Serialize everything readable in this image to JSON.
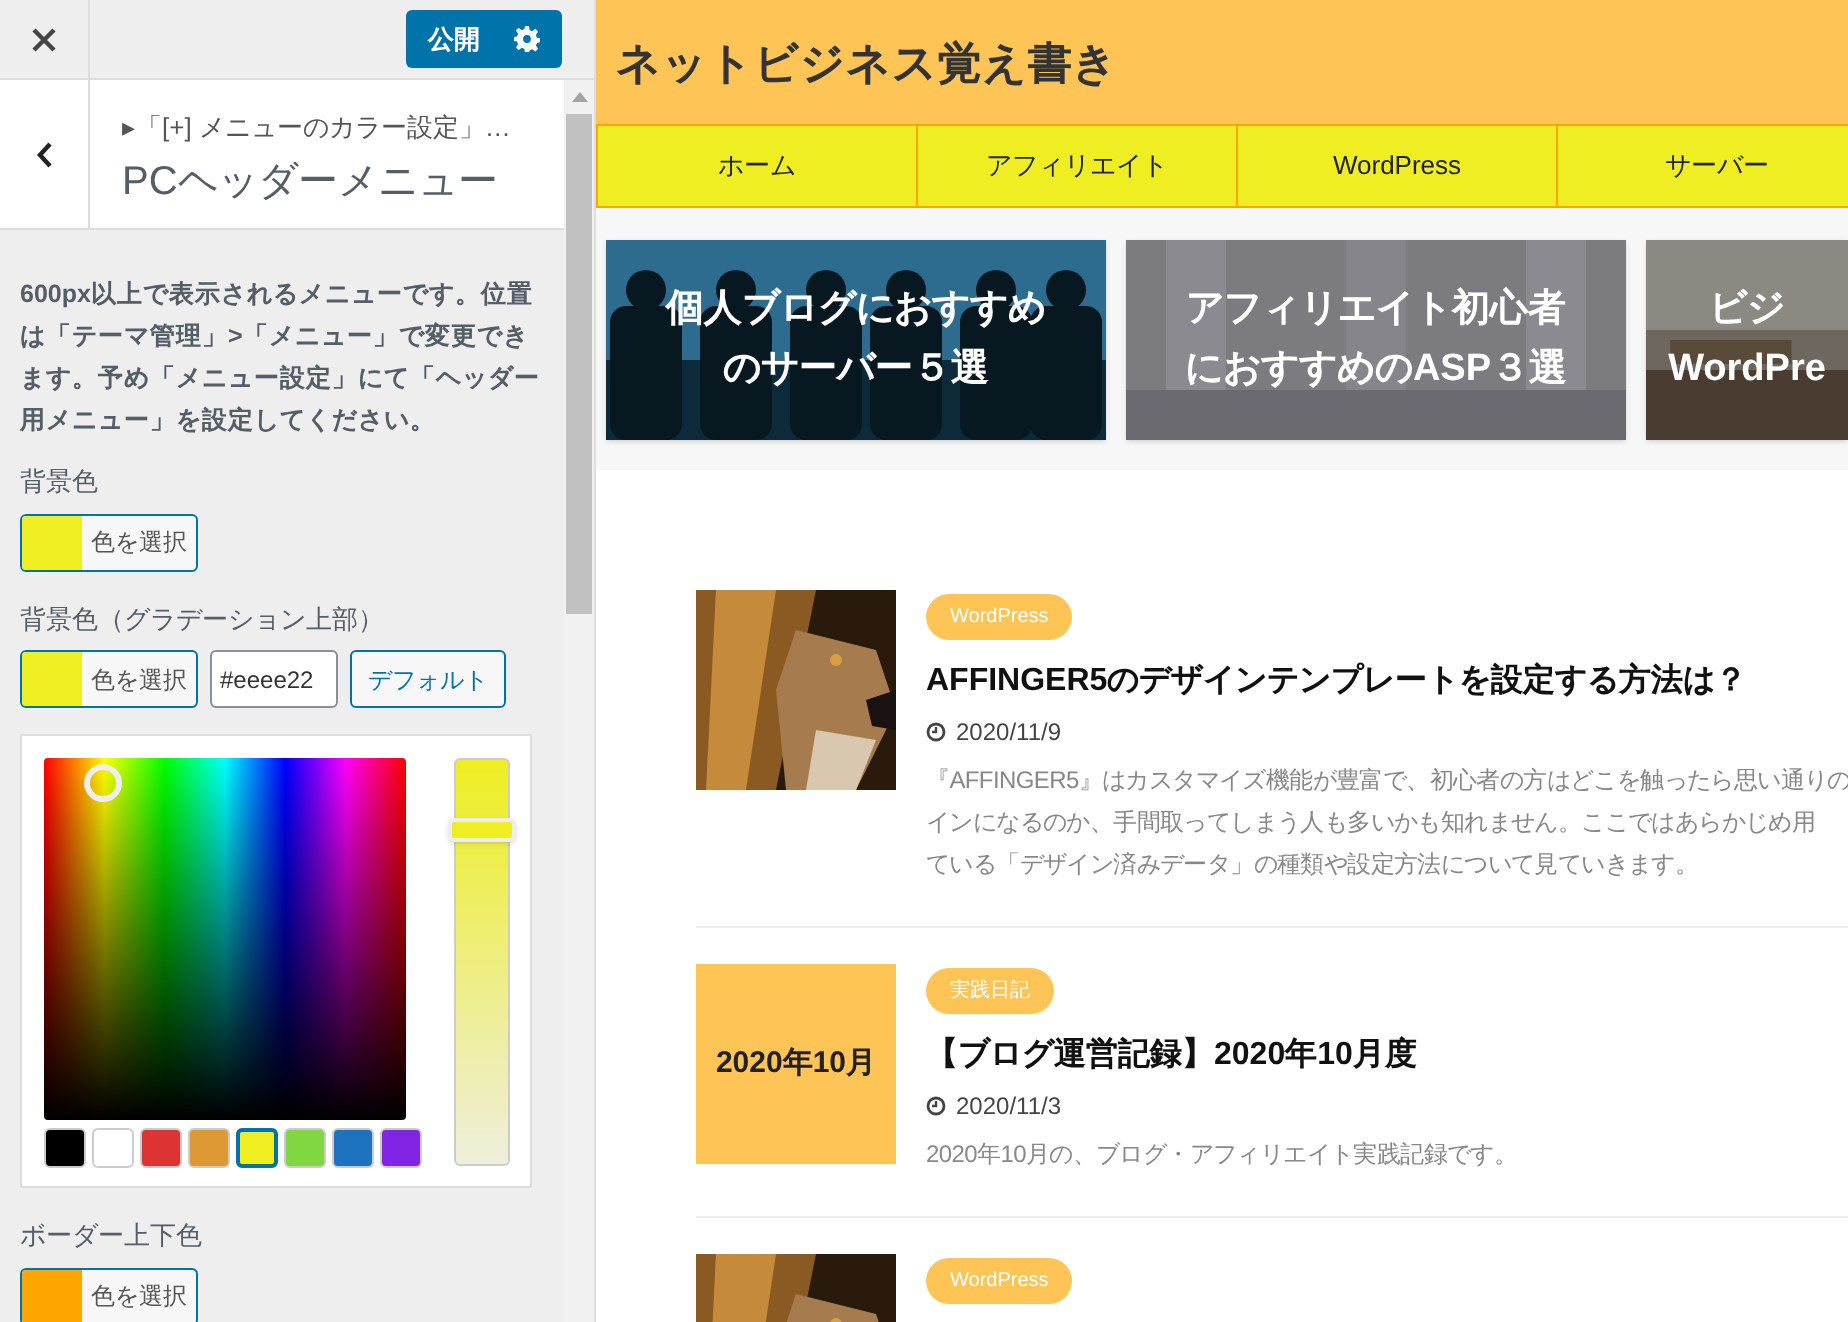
{
  "customizer": {
    "publish_button": "公開",
    "breadcrumb": "▸「[+] メニューのカラー設定」…",
    "section_title": "PCヘッダーメニュー",
    "description": "600px以上で表示されるメニューです。位置は「テーマ管理」>「メニュー」で変更できます。予め「メニュー設定」にて「ヘッダー用メニュー」を設定してください。",
    "controls": [
      {
        "label": "背景色",
        "button": "色を選択",
        "color": "#eeee22"
      },
      {
        "label": "背景色（グラデーション上部）",
        "button": "色を選択",
        "color": "#eeee22",
        "value": "#eeee22",
        "default_button": "デフォルト",
        "picker": {
          "level": 0.85,
          "palette": [
            {
              "color": "#000000",
              "selected": false
            },
            {
              "color": "#ffffff",
              "selected": false
            },
            {
              "color": "#dd3333",
              "selected": false
            },
            {
              "color": "#dd9933",
              "selected": false
            },
            {
              "color": "#eeee22",
              "selected": true
            },
            {
              "color": "#81d742",
              "selected": false
            },
            {
              "color": "#1e73be",
              "selected": false
            },
            {
              "color": "#8224e3",
              "selected": false
            }
          ]
        }
      },
      {
        "label": "ボーダー上下色",
        "button": "色を選択",
        "color": "#ffa500"
      }
    ]
  },
  "site": {
    "title": "ネットビジネス覚え書き",
    "menu": [
      {
        "label": "ホーム"
      },
      {
        "label": "アフィリエイト"
      },
      {
        "label": "WordPress"
      },
      {
        "label": "サーバー"
      }
    ],
    "featured": [
      {
        "lines": [
          "個人ブログにおすすめ",
          "のサーバー５選"
        ],
        "kind": "people"
      },
      {
        "lines": [
          "アフィリエイト初心者",
          "におすすめのASP３選"
        ],
        "kind": "room"
      },
      {
        "lines": [
          "ビジ",
          "WordPre"
        ],
        "kind": "office"
      }
    ],
    "posts": [
      {
        "thumb": {
          "kind": "picture"
        },
        "category": "WordPress",
        "title": "AFFINGER5のデザインテンプレートを設定する方法は？",
        "date": "2020/11/9",
        "excerpt": [
          "『AFFINGER5』はカスタマイズ機能が豊富で、初心者の方はどこを触ったら思い通りの",
          "インになるのか、手間取ってしまう人も多いかも知れません。ここではあらかじめ用",
          "ている「デザイン済みデータ」の種類や設定方法について見ていきます。"
        ]
      },
      {
        "thumb": {
          "kind": "text",
          "label": "2020年10月"
        },
        "category": "実践日記",
        "title": "【ブログ運営記録】2020年10月度",
        "date": "2020/11/3",
        "excerpt": [
          "2020年10月の、ブログ・アフィリエイト実践記録です。"
        ]
      },
      {
        "thumb": {
          "kind": "picture"
        },
        "category": "WordPress"
      }
    ]
  }
}
